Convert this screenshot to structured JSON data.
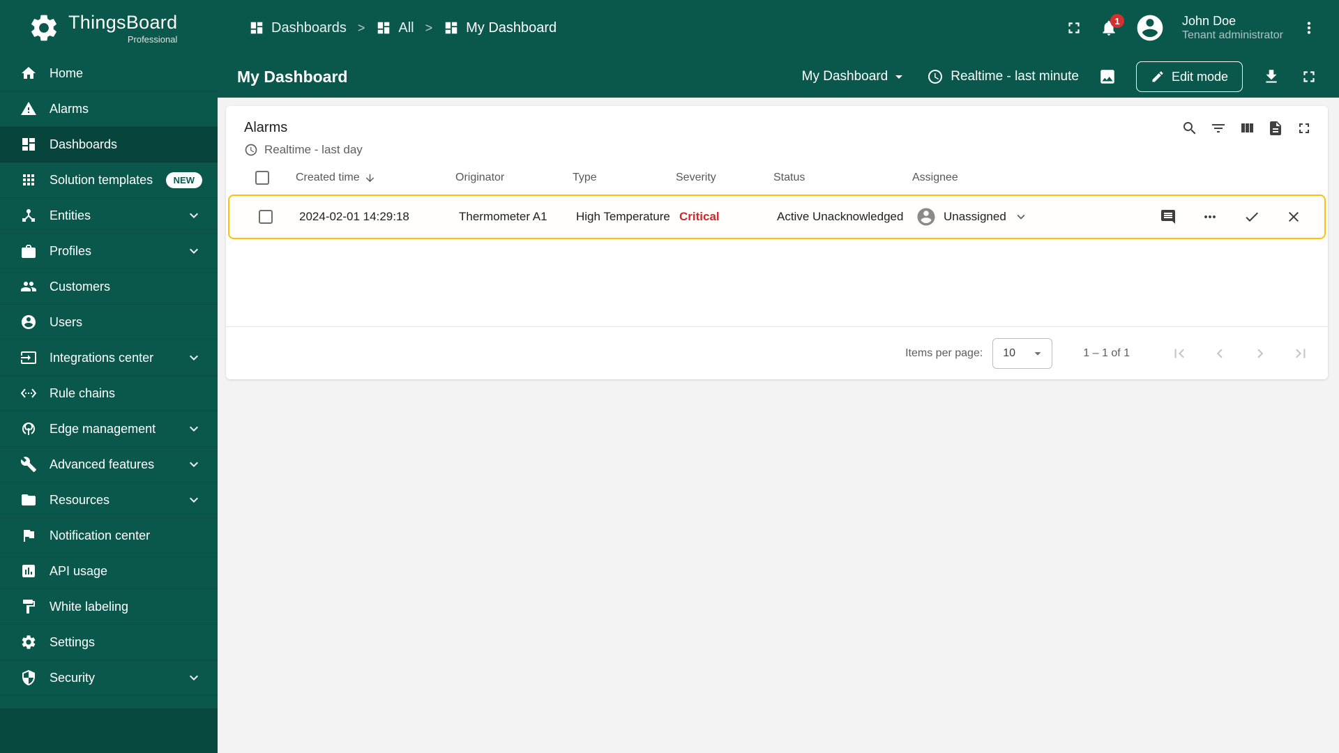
{
  "app": {
    "brand": "ThingsBoard",
    "brand_sub": "Professional"
  },
  "colors": {
    "primary_green": "#0A584C",
    "row_highlight_amber": "#FFC107",
    "critical_red": "#D12730",
    "content_bg": "#F3F3F3"
  },
  "sidebar": {
    "items": [
      {
        "label": "Home",
        "icon": "home"
      },
      {
        "label": "Alarms",
        "icon": "warning-triangle"
      },
      {
        "label": "Dashboards",
        "icon": "dashboards-grid",
        "active": true
      },
      {
        "label": "Solution templates",
        "icon": "apps-grid",
        "badge": "NEW"
      },
      {
        "label": "Entities",
        "icon": "device-hub",
        "expandable": true
      },
      {
        "label": "Profiles",
        "icon": "briefcase",
        "expandable": true
      },
      {
        "label": "Customers",
        "icon": "people"
      },
      {
        "label": "Users",
        "icon": "person-circle"
      },
      {
        "label": "Integrations center",
        "icon": "input-box",
        "expandable": true
      },
      {
        "label": "Rule chains",
        "icon": "ethernet-arrows"
      },
      {
        "label": "Edge management",
        "icon": "wifi-tethering",
        "expandable": true
      },
      {
        "label": "Advanced features",
        "icon": "wrench",
        "expandable": true
      },
      {
        "label": "Resources",
        "icon": "folder",
        "expandable": true
      },
      {
        "label": "Notification center",
        "icon": "flag"
      },
      {
        "label": "API usage",
        "icon": "bar-chart"
      },
      {
        "label": "White labeling",
        "icon": "paint"
      },
      {
        "label": "Settings",
        "icon": "gear"
      },
      {
        "label": "Security",
        "icon": "shield",
        "expandable": true
      }
    ]
  },
  "header": {
    "breadcrumb": [
      {
        "label": "Dashboards"
      },
      {
        "label": "All"
      },
      {
        "label": "My Dashboard"
      }
    ],
    "breadcrumb_separator": ">",
    "notifications_count": "1",
    "user": {
      "name": "John Doe",
      "role": "Tenant administrator"
    }
  },
  "toolbar": {
    "title": "My Dashboard",
    "state_selector": "My Dashboard",
    "timewindow": "Realtime - last minute",
    "edit_button_label": "Edit mode"
  },
  "widget": {
    "title": "Alarms",
    "timewindow": "Realtime - last day",
    "columns": [
      "Created time",
      "Originator",
      "Type",
      "Severity",
      "Status",
      "Assignee"
    ],
    "rows": [
      {
        "created_time": "2024-02-01 14:29:18",
        "originator": "Thermometer A1",
        "type": "High Temperature",
        "severity": "Critical",
        "severity_color": "#D12730",
        "status": "Active Unacknowledged",
        "assignee": "Unassigned"
      }
    ],
    "pagination": {
      "items_per_page_label": "Items per page:",
      "items_per_page": "10",
      "range_label": "1 – 1 of 1"
    }
  }
}
